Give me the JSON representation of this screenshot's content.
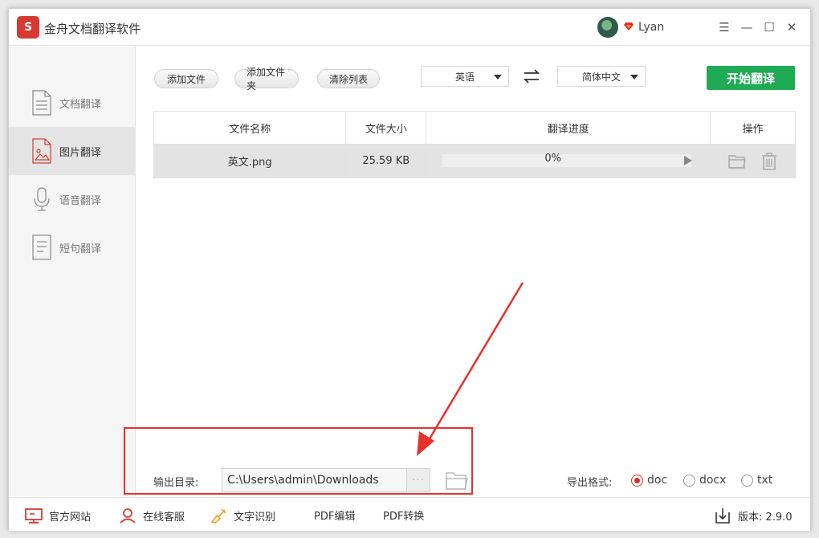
{
  "app": {
    "title": "金舟文档翻译软件",
    "logo_text": "S"
  },
  "user": {
    "name": "Lyan"
  },
  "window_controls": {
    "menu": "☰",
    "minimize": "—",
    "maximize": "☐",
    "close": "✕"
  },
  "sidebar": {
    "items": [
      {
        "label": "文档翻译",
        "icon": "document-icon",
        "active": false
      },
      {
        "label": "图片翻译",
        "icon": "image-icon",
        "active": true
      },
      {
        "label": "语音翻译",
        "icon": "microphone-icon",
        "active": false
      },
      {
        "label": "短句翻译",
        "icon": "text-icon",
        "active": false
      }
    ]
  },
  "toolbar": {
    "add_file": "添加文件",
    "add_folder": "添加文件夹",
    "clear_list": "清除列表",
    "source_lang": "英语",
    "target_lang": "简体中文",
    "start": "开始翻译"
  },
  "table": {
    "headers": [
      "文件名称",
      "文件大小",
      "翻译进度",
      "操作"
    ],
    "rows": [
      {
        "name": "英文.png",
        "size": "25.59 KB",
        "progress_text": "0%",
        "progress": 0
      }
    ]
  },
  "output": {
    "label": "输出目录:",
    "path": "C:\\Users\\admin\\Downloads",
    "dots": "···"
  },
  "export": {
    "label": "导出格式:",
    "options": [
      "doc",
      "docx",
      "txt"
    ],
    "selected": "doc"
  },
  "footer": {
    "website": "官方网站",
    "service": "在线客服",
    "ocr": "文字识别",
    "pdf_edit": "PDF编辑",
    "pdf_convert": "PDF转换",
    "version_label": "版本: 2.9.0"
  },
  "colors": {
    "accent_green": "#1faa54",
    "brand_red": "#d63a33",
    "annotation_red": "#e8302b"
  }
}
